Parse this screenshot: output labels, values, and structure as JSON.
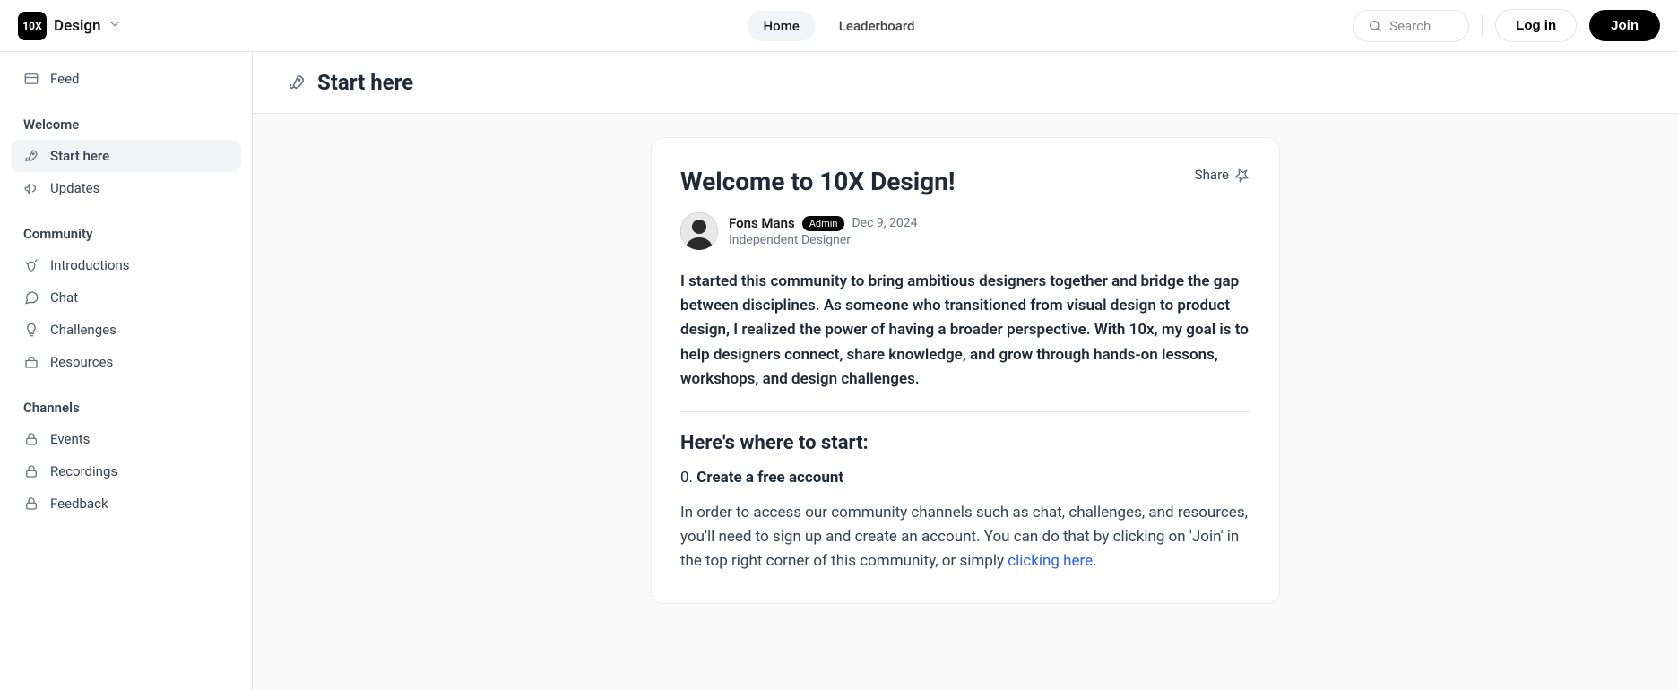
{
  "brand": {
    "logo_text": "10X",
    "name": "Design"
  },
  "nav": {
    "home": "Home",
    "leaderboard": "Leaderboard"
  },
  "search": {
    "placeholder": "Search"
  },
  "auth": {
    "login": "Log in",
    "join": "Join"
  },
  "sidebar": {
    "feed": "Feed",
    "sections": {
      "welcome": {
        "label": "Welcome",
        "start_here": "Start here",
        "updates": "Updates"
      },
      "community": {
        "label": "Community",
        "introductions": "Introductions",
        "chat": "Chat",
        "challenges": "Challenges",
        "resources": "Resources"
      },
      "channels": {
        "label": "Channels",
        "events": "Events",
        "recordings": "Recordings",
        "feedback": "Feedback"
      }
    }
  },
  "page": {
    "title": "Start here"
  },
  "post": {
    "title": "Welcome to 10X Design!",
    "share_label": "Share",
    "author": {
      "name": "Fons Mans",
      "badge": "Admin",
      "date": "Dec 9, 2024",
      "subtitle": "Independent Designer"
    },
    "intro": "I started this community to bring ambitious designers together and bridge the gap between disciplines. As someone who transitioned from visual design to product design, I realized the power of having a broader perspective. With 10x, my goal is to help designers connect, share knowledge, and grow through hands-on lessons, workshops, and design challenges.",
    "section_heading": "Here's where to start:",
    "step0_num": "0.",
    "step0_title": "Create a free account",
    "para1_a": "In order to access our community channels such as chat, challenges, and resources, you'll need to sign up and create an account. You can do that by clicking on 'Join' in the top right corner of this community, or simply ",
    "para1_link": "clicking here",
    "para1_b": "."
  }
}
